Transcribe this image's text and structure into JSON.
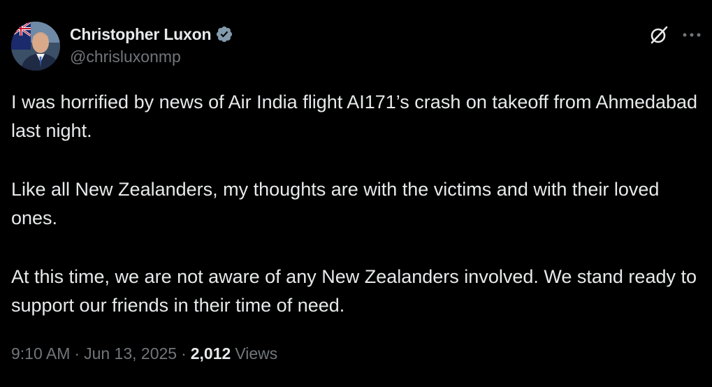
{
  "author": {
    "display_name": "Christopher Luxon",
    "handle": "@chrisluxonmp",
    "verified_icon": "verified-badge-icon",
    "verified_color": "#829aab"
  },
  "actions": {
    "grok_icon": "grok-icon",
    "more_icon": "more-options-icon"
  },
  "tweet": {
    "paragraphs": [
      "I was horrified by news of Air India flight AI171’s crash on takeoff from Ahmedabad last night.",
      "Like all New Zealanders, my thoughts are with the victims and with their loved ones.",
      "At this time, we are not aware of any New Zealanders involved. We stand ready to support our friends in their time of need."
    ]
  },
  "meta": {
    "time": "9:10 AM",
    "separator": "·",
    "date": "Jun 13, 2025",
    "views_count": "2,012",
    "views_label": "Views"
  },
  "colors": {
    "background": "#000000",
    "text_primary": "#e7e9ea",
    "text_secondary": "#71767b"
  }
}
